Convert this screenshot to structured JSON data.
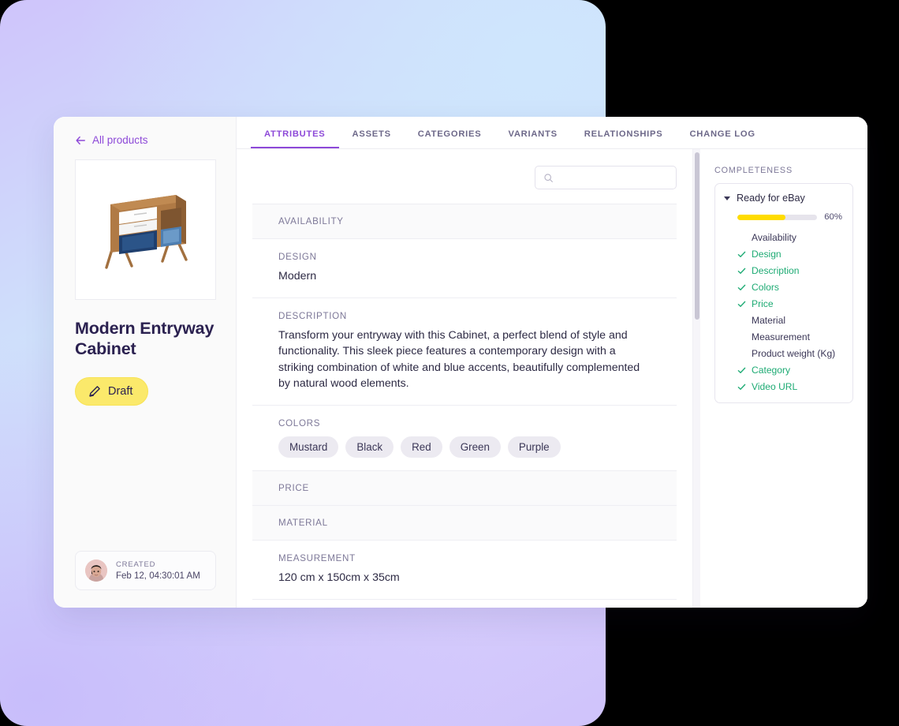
{
  "window": {
    "back_link": "All products"
  },
  "sidebar": {
    "product_title": "Modern Entryway Cabinet",
    "status_badge": "Draft",
    "thumbnail_alt": "Modern entryway cabinet with wood frame, white drawers and blue compartments",
    "created": {
      "label": "CREATED",
      "timestamp": "Feb 12, 04:30:01 AM"
    }
  },
  "tabs": [
    {
      "label": "ATTRIBUTES",
      "active": true
    },
    {
      "label": "ASSETS",
      "active": false
    },
    {
      "label": "CATEGORIES",
      "active": false
    },
    {
      "label": "VARIANTS",
      "active": false
    },
    {
      "label": "RELATIONSHIPS",
      "active": false
    },
    {
      "label": "CHANGE LOG",
      "active": false
    }
  ],
  "search": {
    "value": "",
    "placeholder": ""
  },
  "attributes": [
    {
      "label": "AVAILABILITY",
      "value": "",
      "type": "empty"
    },
    {
      "label": "DESIGN",
      "value": "Modern",
      "type": "text"
    },
    {
      "label": "DESCRIPTION",
      "value": "Transform your entryway with this Cabinet, a perfect blend of style and functionality. This sleek piece features a contemporary design with a striking combination of white and blue accents, beautifully complemented by natural wood elements.",
      "type": "text"
    },
    {
      "label": "COLORS",
      "value": "",
      "type": "chips",
      "chips": [
        "Mustard",
        "Black",
        "Red",
        "Green",
        "Purple"
      ]
    },
    {
      "label": "PRICE",
      "value": "",
      "type": "empty"
    },
    {
      "label": "MATERIAL",
      "value": "",
      "type": "empty"
    },
    {
      "label": "MEASUREMENT",
      "value": "120 cm x 150cm x 35cm",
      "type": "text"
    }
  ],
  "completeness": {
    "title": "COMPLETENESS",
    "group_label": "Ready for eBay",
    "percent_label": "60%",
    "percent_value": 60,
    "items": [
      {
        "label": "Availability",
        "done": false
      },
      {
        "label": "Design",
        "done": true
      },
      {
        "label": "Description",
        "done": true
      },
      {
        "label": "Colors",
        "done": true
      },
      {
        "label": "Price",
        "done": true
      },
      {
        "label": "Material",
        "done": false
      },
      {
        "label": "Measurement",
        "done": false
      },
      {
        "label": "Product weight (Kg)",
        "done": false
      },
      {
        "label": "Category",
        "done": true
      },
      {
        "label": "Video URL",
        "done": true
      }
    ]
  },
  "colors": {
    "accent_purple": "#8d49d8",
    "badge_yellow": "#fbe96b",
    "progress_yellow": "#ffdc00",
    "check_green": "#1eab74",
    "heading_navy": "#2b2150"
  }
}
